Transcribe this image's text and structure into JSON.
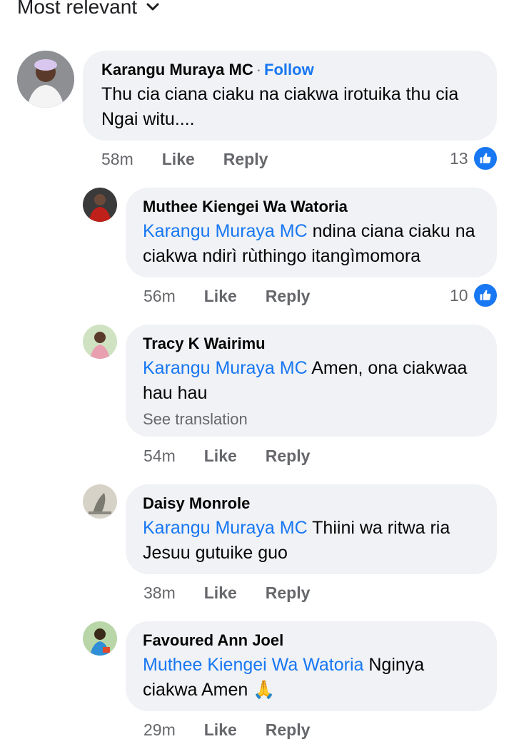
{
  "sort": {
    "label": "Most relevant"
  },
  "comments": [
    {
      "author": "Karangu Muraya MC",
      "follow": "Follow",
      "separator": "·",
      "mention": "",
      "text": "Thu cia ciana ciaku na ciakwa irotuika thu cia Ngai witu....",
      "time": "58m",
      "like": "Like",
      "reply": "Reply",
      "reactions": "13"
    },
    {
      "author": "Muthee Kiengei Wa Watoria",
      "mention": "Karangu Muraya MC",
      "text": "ndina ciana ciaku na ciakwa ndirì rùthingo itangìmomora",
      "time": "56m",
      "like": "Like",
      "reply": "Reply",
      "reactions": "10"
    },
    {
      "author": "Tracy K Wairimu",
      "mention": "Karangu Muraya MC",
      "text": "Amen, ona ciakwaa hau hau",
      "see_translation": "See translation",
      "time": "54m",
      "like": "Like",
      "reply": "Reply"
    },
    {
      "author": "Daisy Monrole",
      "mention": "Karangu Muraya MC",
      "text": "Thiini wa ritwa ria Jesuu gutuike guo",
      "time": "38m",
      "like": "Like",
      "reply": "Reply"
    },
    {
      "author": "Favoured Ann Joel",
      "mention": "Muthee Kiengei Wa Watoria",
      "text": "Nginya ciakwa Amen 🙏",
      "time": "29m",
      "like": "Like",
      "reply": "Reply"
    }
  ]
}
